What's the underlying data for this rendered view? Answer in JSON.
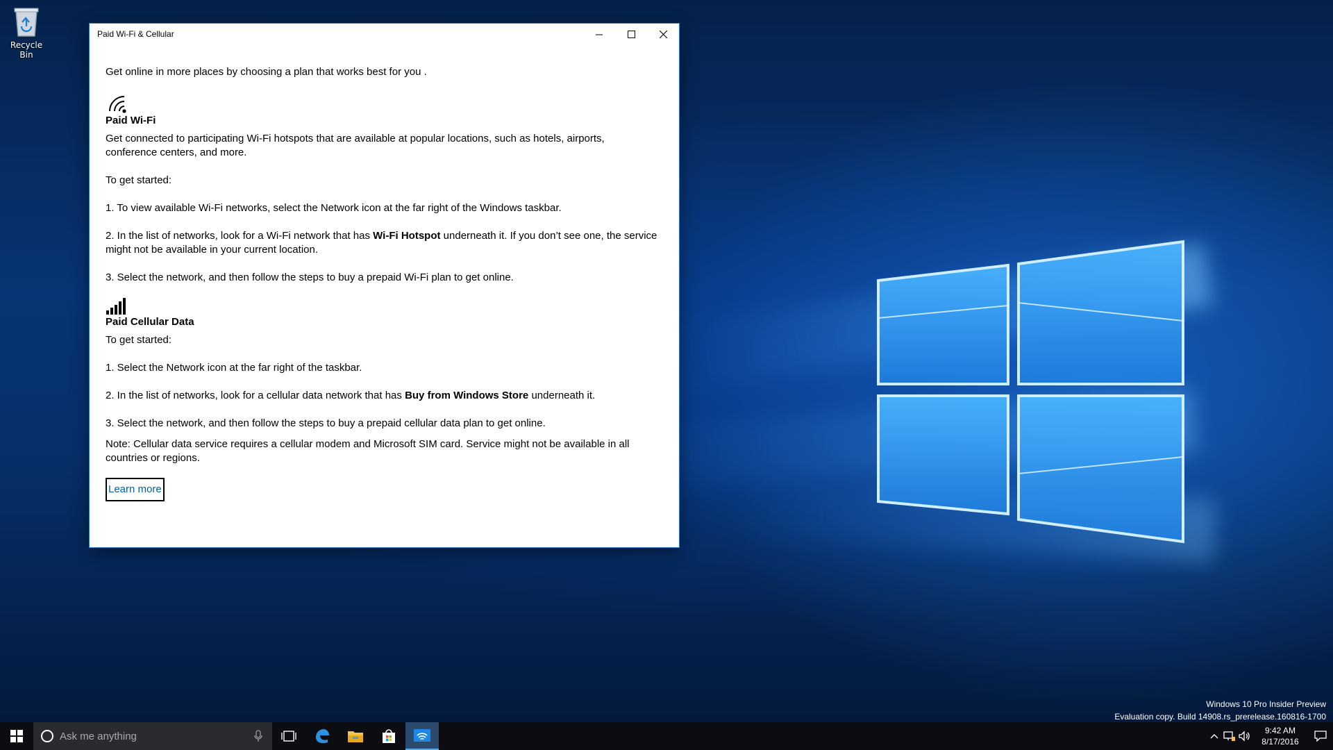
{
  "desktop": {
    "icons": [
      {
        "label": "Recycle Bin",
        "icon": "recycle-bin-icon"
      }
    ],
    "watermark": {
      "line1": "Windows 10 Pro Insider Preview",
      "line2": "Evaluation copy. Build 14908.rs_prerelease.160816-1700"
    }
  },
  "window": {
    "title": "Paid Wi-Fi & Cellular",
    "controls": {
      "minimize": "minimize-icon",
      "maximize": "maximize-icon",
      "close": "close-icon"
    },
    "intro": "Get online in more places by choosing a plan that works best for you .",
    "wifi": {
      "icon": "wifi-icon",
      "heading": "Paid Wi-Fi",
      "description": "Get connected to participating Wi-Fi hotspots that are available at popular locations, such as hotels, airports, conference centers, and more.",
      "getting_started": "To get started:",
      "step1": "1. To view available Wi-Fi networks, select the Network icon at the far right of the Windows taskbar.",
      "step2_pre": "2. In the list of networks, look for a Wi-Fi network that has ",
      "step2_bold": "Wi-Fi Hotspot",
      "step2_post": " underneath it. If you don’t see one, the service might not be available in your current location.",
      "step3": "3. Select the network, and then follow the steps to buy a prepaid Wi-Fi plan to get online."
    },
    "cellular": {
      "icon": "cellular-signal-icon",
      "heading": "Paid Cellular Data",
      "getting_started": "To get started:",
      "step1": "1. Select the Network icon at the far right of the taskbar.",
      "step2_pre": "2. In the list of networks, look for a cellular data network that has ",
      "step2_bold": "Buy from Windows Store",
      "step2_post": " underneath it.",
      "step3": "3. Select the network, and then follow the steps to buy a prepaid cellular data plan to get online.",
      "note": "Note: Cellular data service requires a cellular modem and Microsoft SIM card. Service might not be available in all countries or regions."
    },
    "learn_more": "Learn more"
  },
  "taskbar": {
    "search_placeholder": "Ask me anything",
    "apps": [
      "task-view-icon",
      "edge-icon",
      "file-explorer-icon",
      "store-icon",
      "paid-wifi-app-icon"
    ],
    "clock": {
      "time": "9:42 AM",
      "date": "8/17/2016"
    }
  },
  "colors": {
    "accent": "#0078d7",
    "link": "#0063b1",
    "taskbar": "#0b0d12"
  }
}
